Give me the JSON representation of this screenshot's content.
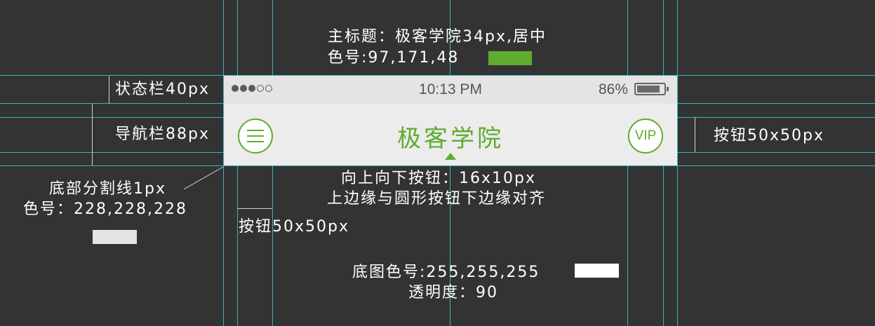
{
  "colors": {
    "brand_green": "#61ab30",
    "divider_gray": "#e4e4e4",
    "guide_cyan": "#3fc8d0",
    "canvas": "#333333"
  },
  "annotations": {
    "title_spec": "主标题：极客学院34px,居中",
    "title_color": "色号:97,171,48",
    "statusbar_spec": "状态栏40px",
    "navbar_spec": "导航栏88px",
    "divider_spec": "底部分割线1px",
    "divider_color": "色号：228,228,228",
    "right_button_spec": "按钮50x50px",
    "arrow_spec": "向上向下按钮：16x10px",
    "arrow_align": "上边缘与圆形按钮下边缘对齐",
    "left_button_spec": "按钮50x50px",
    "bg_color": "底图色号:255,255,255",
    "bg_opacity": "透明度：90"
  },
  "statusbar": {
    "signal_filled": 3,
    "signal_empty": 2,
    "time": "10:13 PM",
    "battery_percent": "86%",
    "battery_level": 0.86
  },
  "navbar": {
    "title": "极客学院",
    "vip_label": "VIP",
    "menu_icon": "hamburger-menu-icon",
    "arrow_icon": "arrow-up-icon"
  }
}
